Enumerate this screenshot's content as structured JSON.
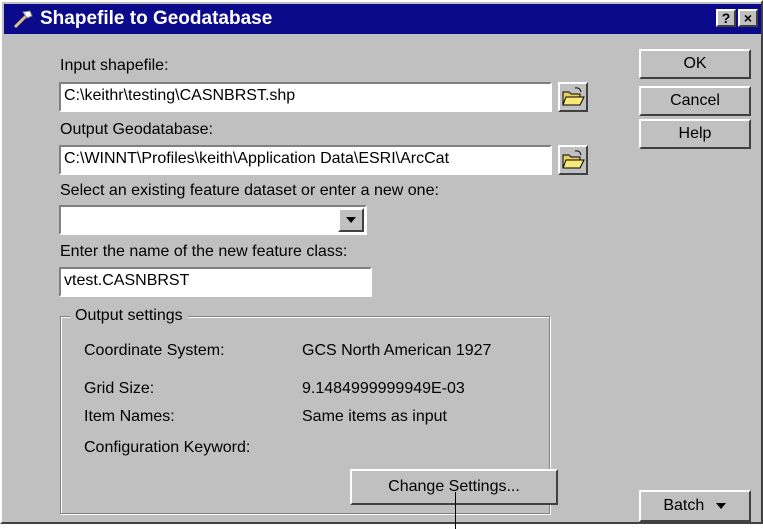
{
  "window": {
    "title": "Shapefile to Geodatabase",
    "help_glyph": "?",
    "close_glyph": "×"
  },
  "form": {
    "input_shapefile_label": "Input shapefile:",
    "input_shapefile_value": "C:\\keithr\\testing\\CASNBRST.shp",
    "output_gdb_label": "Output Geodatabase:",
    "output_gdb_value": "C:\\WINNT\\Profiles\\keith\\Application Data\\ESRI\\ArcCat",
    "dataset_label": "Select an existing feature dataset or enter a new one:",
    "dataset_value": "",
    "feature_class_label": "Enter the name of the new feature class:",
    "feature_class_value": "vtest.CASNBRST"
  },
  "output_settings": {
    "legend": "Output settings",
    "rows": [
      {
        "label": "Coordinate System:",
        "value": "GCS North American 1927"
      },
      {
        "label": "Grid Size:",
        "value": "9.1484999999949E-03"
      },
      {
        "label": "Item Names:",
        "value": "Same items as input"
      },
      {
        "label": "Configuration Keyword:",
        "value": ""
      }
    ],
    "change_button": "Change Settings..."
  },
  "buttons": {
    "ok": "OK",
    "cancel": "Cancel",
    "help": "Help",
    "batch": "Batch"
  },
  "icons": {
    "title": "hammer-icon",
    "browse": "open-folder-icon",
    "dropdown": "chevron-down-icon"
  },
  "colors": {
    "titlebar": "#0a0a8a",
    "face": "#c0c0c0"
  }
}
